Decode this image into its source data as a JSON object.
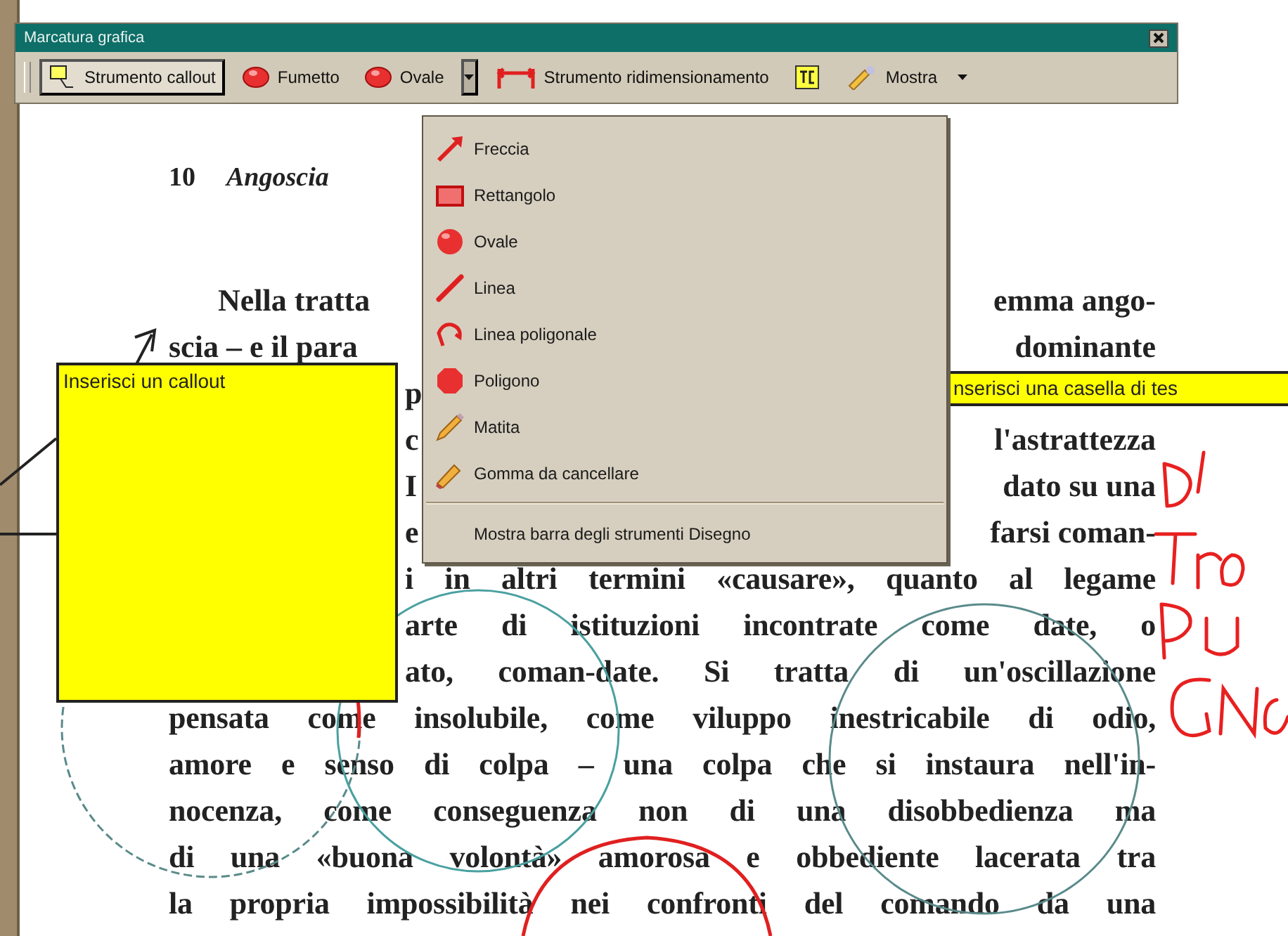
{
  "toolbar": {
    "title": "Marcatura grafica",
    "buttons": [
      {
        "kind": "callout",
        "label": "Strumento callout",
        "selected": true
      },
      {
        "kind": "balloon",
        "label": "Fumetto",
        "selected": false
      },
      {
        "kind": "oval",
        "label": "Ovale",
        "selected": false,
        "expanded": true
      },
      {
        "kind": "resize",
        "label": "Strumento ridimensionamento",
        "selected": false
      },
      {
        "kind": "textbox",
        "selected": false
      },
      {
        "kind": "show",
        "label": "Mostra",
        "selected": false,
        "expanded": false
      }
    ]
  },
  "drawing_menu": {
    "items": [
      {
        "kind": "arrow",
        "label": "Freccia"
      },
      {
        "kind": "rectangle",
        "label": "Rettangolo"
      },
      {
        "kind": "oval",
        "label": "Ovale"
      },
      {
        "kind": "line",
        "label": "Linea"
      },
      {
        "kind": "polyline",
        "label": "Linea poligonale"
      },
      {
        "kind": "polygon",
        "label": "Poligono"
      },
      {
        "kind": "pencil",
        "label": "Matita"
      },
      {
        "kind": "eraser",
        "label": "Gomma da cancellare"
      }
    ],
    "footer": "Mostra barra degli strumenti Disegno"
  },
  "document": {
    "page_number": "10",
    "chapter": "Angoscia",
    "lines": [
      {
        "kind": "indented",
        "left": "Nella tratta",
        "right": "emma ango-"
      },
      {
        "kind": "plain",
        "left": "scia – e il para",
        "right": "dominante"
      },
      {
        "kind": "partial",
        "left": "p"
      },
      {
        "kind": "partial",
        "left": "c",
        "right": "l'astrattezza"
      },
      {
        "kind": "partial",
        "left": "I",
        "right": "dato su una"
      },
      {
        "kind": "partial",
        "left": "e",
        "right": "farsi coman-"
      },
      {
        "kind": "partial",
        "text": "i in altri termini «causare», quanto al legame"
      },
      {
        "kind": "partial",
        "text": "arte di istituzioni incontrate come date, o"
      },
      {
        "kind": "partial",
        "text": "ato, coman-date. Si tratta di un'oscillazione"
      },
      {
        "kind": "plain",
        "text": "pensata come insolubile, come viluppo inestricabile di odio,"
      },
      {
        "kind": "plain",
        "text": "amore e senso di colpa – una colpa che si instaura nell'in-"
      },
      {
        "kind": "plain",
        "text": "nocenza, come conseguenza non di una disobbedienza ma"
      },
      {
        "kind": "plain",
        "text": "di una «buona volontà» amorosa e obbediente lacerata tra"
      },
      {
        "kind": "plain",
        "text": "la propria impossibilità nei confronti del comando da una"
      }
    ]
  },
  "callout": {
    "text": "Inserisci un callout"
  },
  "text_box": {
    "text": "nserisci una casella di tes"
  }
}
